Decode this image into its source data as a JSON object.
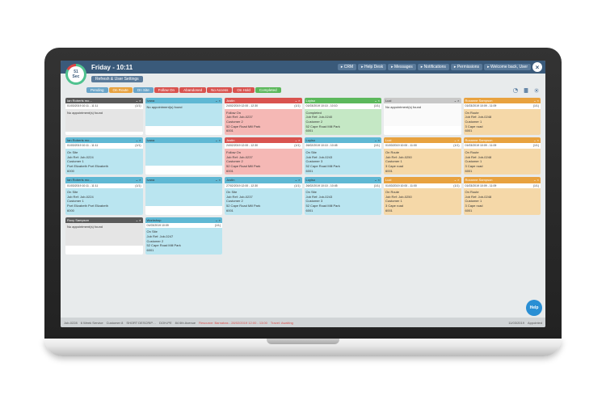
{
  "timer": {
    "value": "51",
    "unit": "Sec"
  },
  "title": "Friday - 10:11",
  "subbar": {
    "refresh": "Refresh & User Settings"
  },
  "topButtons": [
    {
      "label": "CRM"
    },
    {
      "label": "Help Desk"
    },
    {
      "label": "Messages"
    },
    {
      "label": "Notifications"
    },
    {
      "label": "Permissions"
    },
    {
      "label": "Welcome back, User"
    }
  ],
  "statuses": [
    {
      "label": "Pending",
      "color": "#6aa5c9"
    },
    {
      "label": "On Route",
      "color": "#e8a23f"
    },
    {
      "label": "On Site",
      "color": "#6aa5c9"
    },
    {
      "label": "Follow On",
      "color": "#d9534f"
    },
    {
      "label": "Abandoned",
      "color": "#d9534f"
    },
    {
      "label": "No Access",
      "color": "#d9534f"
    },
    {
      "label": "On Hold",
      "color": "#d9534f"
    },
    {
      "label": "Completed",
      "color": "#5cb85c"
    }
  ],
  "cards": [
    {
      "cls": "c-grey",
      "name": "Ian Roberts mo…",
      "time": "01/03/2019 10:11 - 11:11",
      "count": "(1/1)",
      "body": [
        "No appointment(s) found"
      ]
    },
    {
      "cls": "c-cyan",
      "name": "Ivana",
      "time": "",
      "count": "",
      "body": [
        "No appointment(s) found"
      ]
    },
    {
      "cls": "c-red",
      "name": "Justin",
      "time": "24/02/2019 12:00 - 12:30",
      "count": "(1/1)",
      "body": [
        "Follow On",
        "Job Ref: Job-0237",
        "Customer 2",
        "52 Cape Road Mill Park",
        "6001"
      ]
    },
    {
      "cls": "c-green",
      "name": "Loyiso",
      "time": "01/03/2019 10:10 - 10:10",
      "count": "(1/1)",
      "body": [
        "Completed",
        "Job Ref: Job-0240",
        "Customer 2",
        "52 Cape Road Mill Park",
        "6001"
      ]
    },
    {
      "cls": "c-white",
      "name": "Luci",
      "time": "",
      "count": "",
      "body": [
        "No appointment(s) found"
      ]
    },
    {
      "cls": "c-orange",
      "name": "Roxanne Sampson",
      "time": "01/03/2019 10:09 - 11:09",
      "count": "(1/1)",
      "body": [
        "On Route",
        "Job Ref: Job-0248",
        "Customer 1",
        "3 Cape road",
        "6001"
      ]
    },
    {
      "cls": "c-cyan",
      "name": "Ian Roberts mo…",
      "time": "01/03/2019 10:11 - 11:11",
      "count": "(1/1)",
      "body": [
        "On Site",
        "Job Ref: Job-0224",
        "Customer 1",
        "Port Elizabeth Port Elizabeth",
        "6000"
      ]
    },
    {
      "cls": "c-cyan",
      "name": "Ivana",
      "time": "",
      "count": "",
      "body": [
        ""
      ]
    },
    {
      "cls": "c-red",
      "name": "Justin",
      "time": "24/02/2019 12:00 - 12:30",
      "count": "(1/1)",
      "body": [
        "Follow On",
        "Job Ref: Job-0237",
        "Customer 2",
        "52 Cape Road Mill Park",
        "6001"
      ]
    },
    {
      "cls": "c-cyan",
      "name": "Loyiso",
      "time": "26/02/2019 10:10 - 10:45",
      "count": "(1/1)",
      "body": [
        "On Site",
        "Job Ref: Job-0243",
        "Customer 3",
        "52 Cape Road Mill Park",
        "6001"
      ]
    },
    {
      "cls": "c-orange",
      "name": "Luci",
      "time": "01/03/2019 10:00 - 11:00",
      "count": "(1/1)",
      "body": [
        "On Route",
        "Job Ref: Job-0250",
        "Customer 1",
        "3 Cape road",
        "6001"
      ]
    },
    {
      "cls": "c-orange",
      "name": "Roxanne Sampson",
      "time": "01/03/2019 10:09 - 11:09",
      "count": "(1/1)",
      "body": [
        "On Route",
        "Job Ref: Job-0248",
        "Customer 1",
        "3 Cape road",
        "6001"
      ]
    },
    {
      "cls": "c-cyan",
      "name": "Ian Roberts mo…",
      "time": "01/03/2019 10:11 - 11:11",
      "count": "(1/1)",
      "body": [
        "On Site",
        "Job Ref: Job-0224",
        "Customer 1",
        "Port Elizabeth Port Elizabeth",
        "6000"
      ]
    },
    {
      "cls": "c-cyan",
      "name": "Ivana",
      "time": "",
      "count": "",
      "body": [
        ""
      ]
    },
    {
      "cls": "c-cyan",
      "name": "Justin",
      "time": "27/02/2019 12:00 - 12:30",
      "count": "(1/1)",
      "body": [
        "On Site",
        "Job Ref: Job-0237",
        "Customer 2",
        "52 Cape Road Mill Park",
        "6001"
      ]
    },
    {
      "cls": "c-cyan",
      "name": "Loyiso",
      "time": "26/02/2019 10:10 - 10:45",
      "count": "(1/1)",
      "body": [
        "On Site",
        "Job Ref: Job-0243",
        "Customer 3",
        "52 Cape Road Mill Park",
        "6001"
      ]
    },
    {
      "cls": "c-orange",
      "name": "Luci",
      "time": "01/03/2019 10:00 - 11:00",
      "count": "(1/1)",
      "body": [
        "On Route",
        "Job Ref: Job-0250",
        "Customer 1",
        "3 Cape road",
        "6001"
      ]
    },
    {
      "cls": "c-orange",
      "name": "Roxanne Sampson",
      "time": "01/03/2019 10:09 - 11:09",
      "count": "(1/1)",
      "body": [
        "On Route",
        "Job Ref: Job-0248",
        "Customer 1",
        "3 Cape road",
        "6001"
      ]
    },
    {
      "cls": "c-grey",
      "name": "Roxy Sampson",
      "time": "",
      "count": "",
      "body": [
        "No appointment(s) found"
      ]
    },
    {
      "cls": "c-cyan",
      "name": "Workshop",
      "time": "01/03/2019 10:09",
      "count": "(1/1)",
      "body": [
        "On Site",
        "Job Ref: Job-0247",
        "Customer 2",
        "52 Cape Road Mill Park",
        "6001"
      ]
    }
  ],
  "bottom": {
    "jobId": "Job-0228",
    "service": "6 Week Service",
    "customer": "Customer 8",
    "desc": "SHORT DESCRIP…",
    "branch": "DOH-PE",
    "addr": "84 6th Avenue",
    "resource": "Resource: Barnabas - 28/02/2019 12:00 - 13:00",
    "travel": "Travel: Awaiting",
    "date": "11/03/2019",
    "status": "Appointed"
  },
  "help": "Help"
}
